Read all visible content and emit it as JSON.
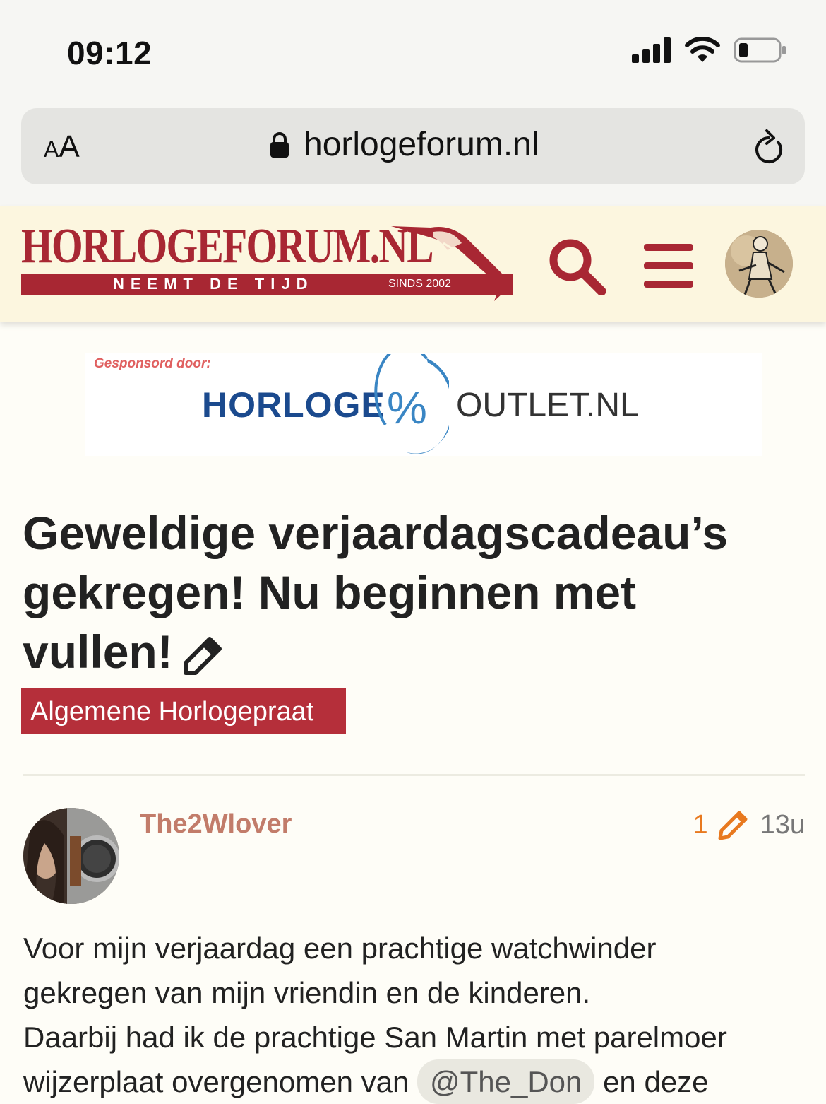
{
  "status_bar": {
    "time": "09:12",
    "icons": [
      "signal-icon",
      "wifi-icon",
      "battery-icon"
    ]
  },
  "browser": {
    "text_size_label_small": "A",
    "text_size_label_large": "A",
    "url": "horlogeforum.nl",
    "lock_icon": "lock-icon",
    "reload_icon": "reload-icon"
  },
  "header": {
    "logo_title": "HORLOGEFORUM.NL",
    "logo_slogan": "NEEMT DE TIJD",
    "logo_since": "SINDS 2002",
    "search_icon": "search-icon",
    "menu_icon": "hamburger-icon",
    "brand_color": "#a82733"
  },
  "sponsor": {
    "label": "Gesponsord door:",
    "brand_left": "HORLOGE",
    "brand_mark": "%",
    "brand_right": "OUTLET.NL"
  },
  "topic": {
    "title": "Geweldige verjaardagscadeau’s gekregen! Nu beginnen met vullen!",
    "category": "Algemene Horlogepraat",
    "category_color": "#b52f3a"
  },
  "post": {
    "username": "The2Wlover",
    "edit_count": "1",
    "age": "13u",
    "body_line1": "Voor mijn verjaardag een prachtige watchwinder",
    "body_line2": "gekregen van mijn vriendin en de kinderen.",
    "body_line3": "Daarbij had ik de prachtige San Martin met parelmoer",
    "body_line4_start": "wijzerplaat overgenomen van",
    "body_mention": "@The_Don",
    "body_line4_end": "en deze"
  }
}
